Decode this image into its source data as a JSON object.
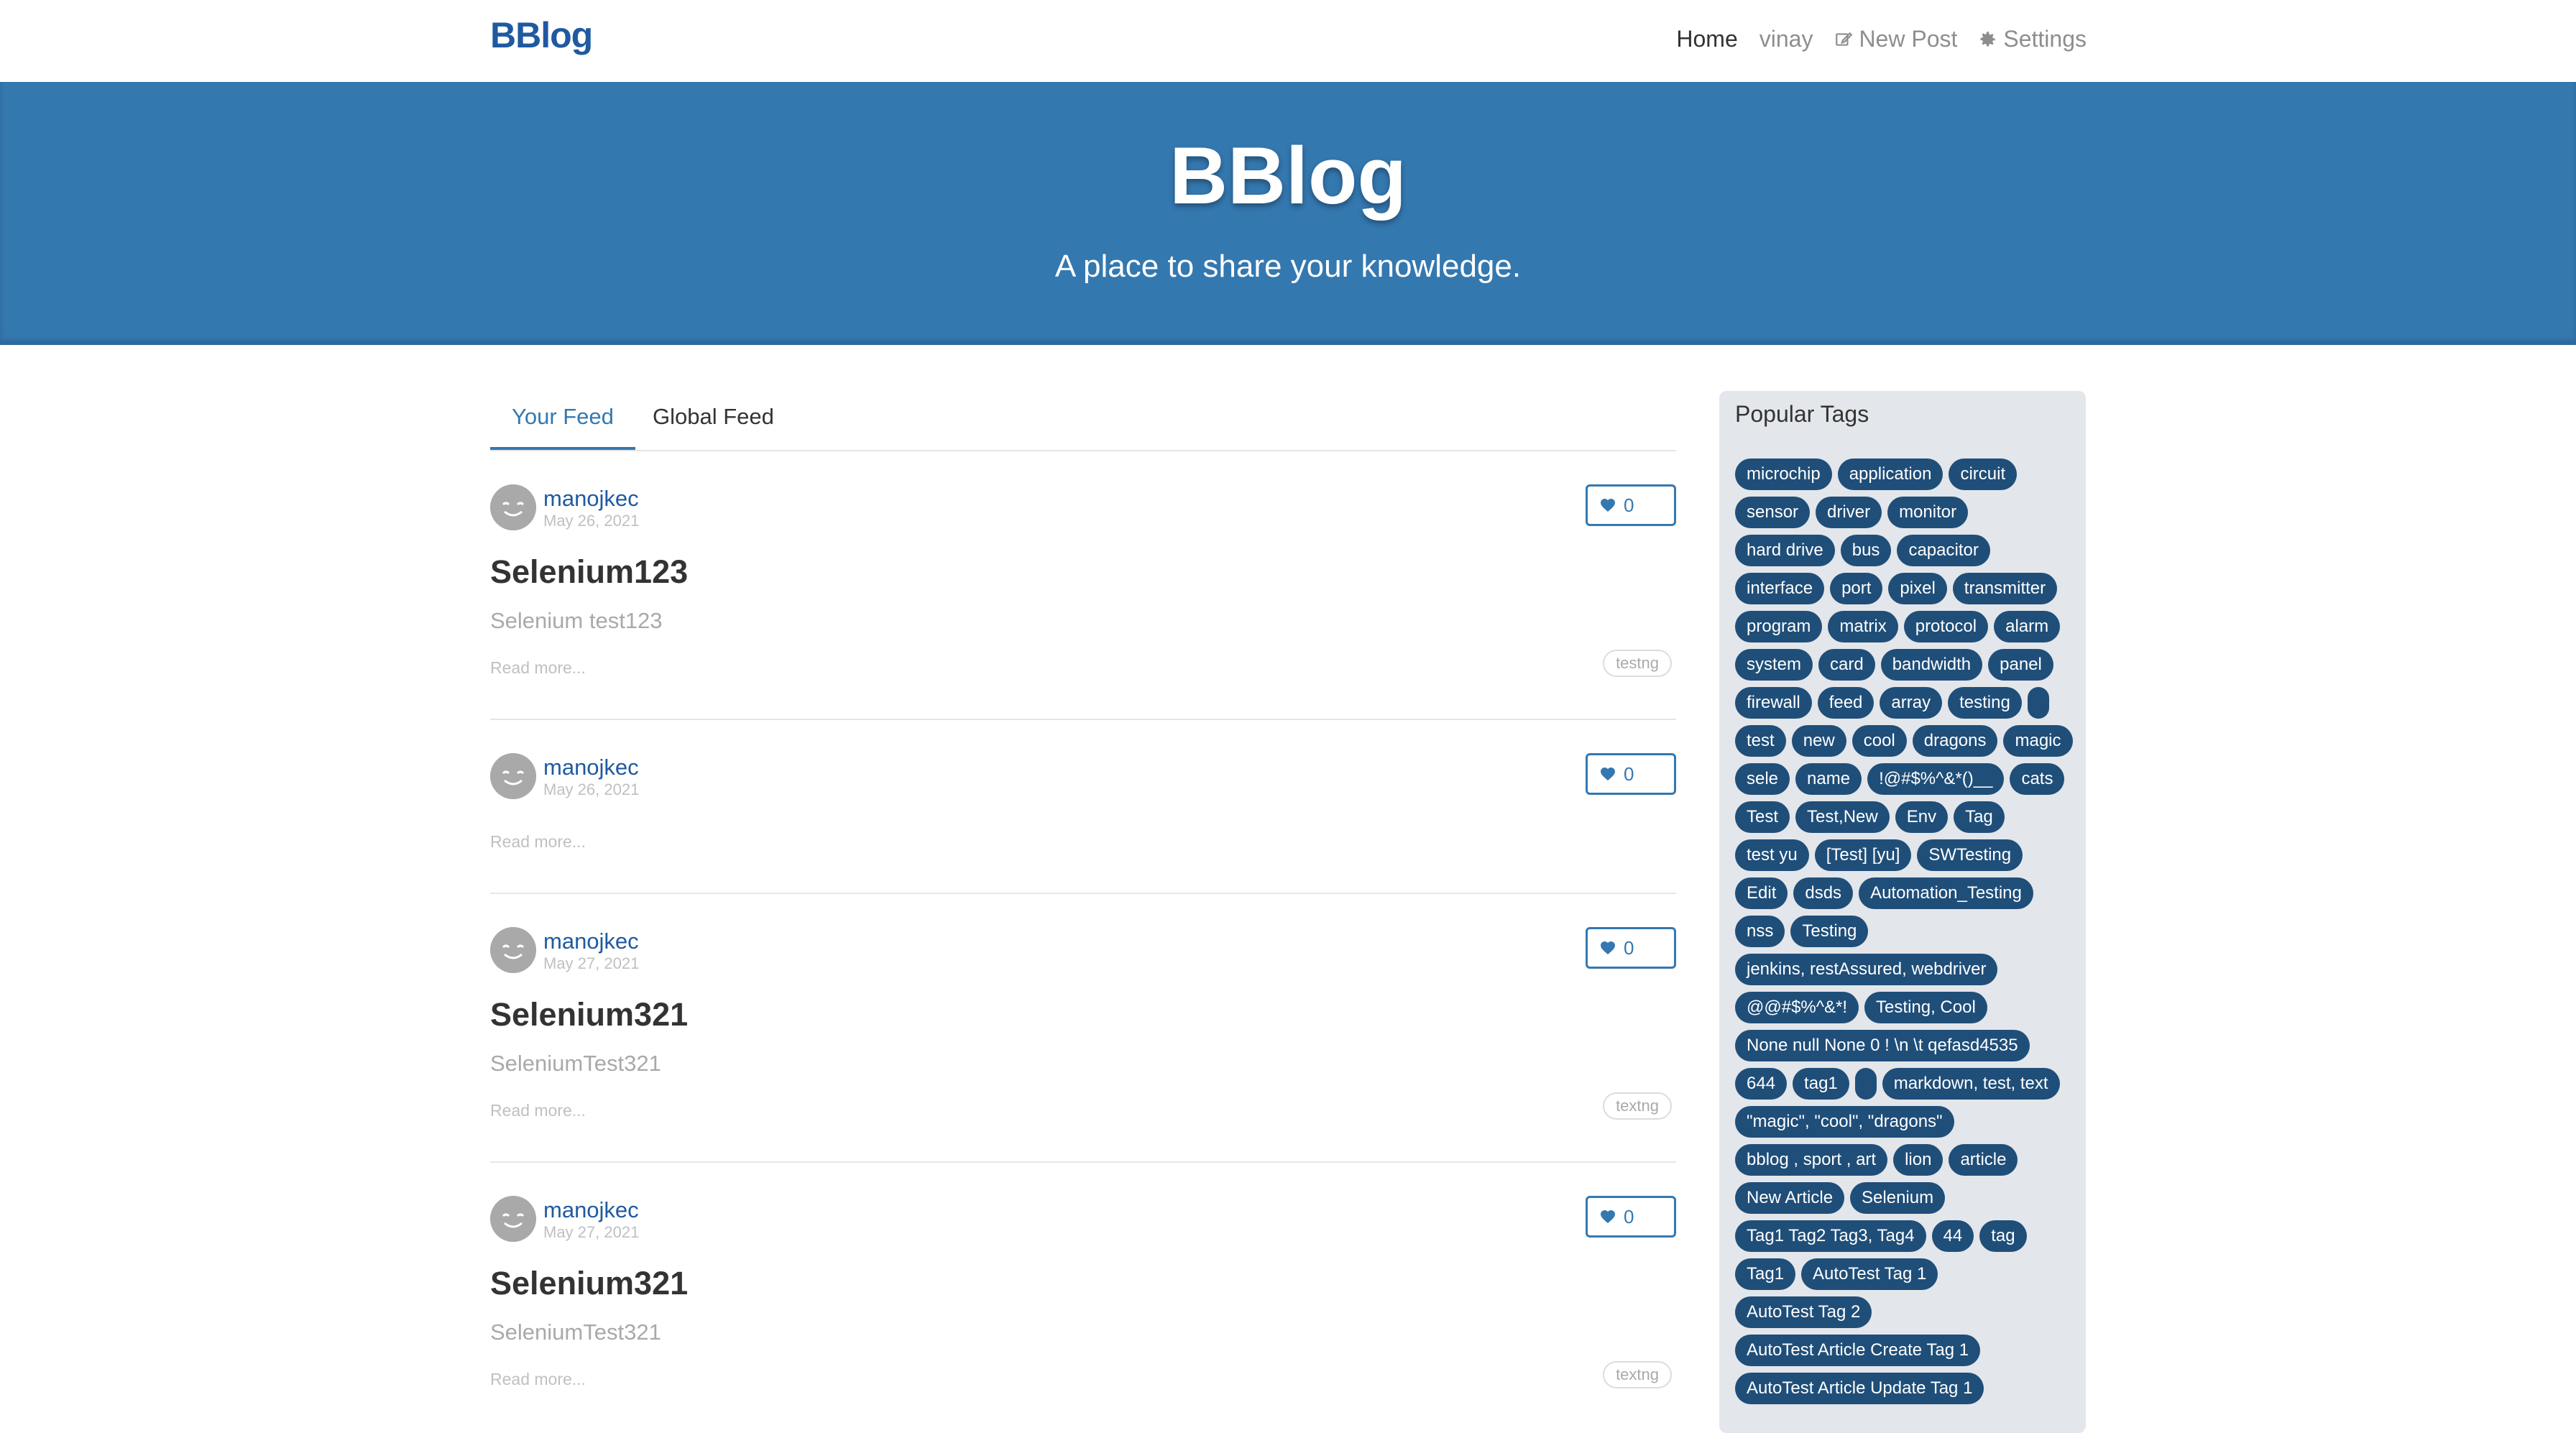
{
  "nav": {
    "brand": "BBlog",
    "links": [
      {
        "label": "Home",
        "icon": ""
      },
      {
        "label": "vinay",
        "icon": ""
      },
      {
        "label": "New Post",
        "icon": "edit-icon"
      },
      {
        "label": "Settings",
        "icon": "gear-icon"
      }
    ]
  },
  "banner": {
    "title": "BBlog",
    "subtitle": "A place to share your knowledge."
  },
  "feed": {
    "tabs": [
      "Your Feed",
      "Global Feed"
    ],
    "articles": [
      {
        "author": "manojkec",
        "date": "May 26, 2021",
        "likes": "0",
        "title": "Selenium123",
        "description": "Selenium test123",
        "read_more": "Read more...",
        "tag": "testng"
      },
      {
        "author": "manojkec",
        "date": "May 26, 2021",
        "likes": "0",
        "title": "",
        "description": "",
        "read_more": "Read more...",
        "tag": ""
      },
      {
        "author": "manojkec",
        "date": "May 27, 2021",
        "likes": "0",
        "title": "Selenium321",
        "description": "SeleniumTest321",
        "read_more": "Read more...",
        "tag": "textng"
      },
      {
        "author": "manojkec",
        "date": "May 27, 2021",
        "likes": "0",
        "title": "Selenium321",
        "description": "SeleniumTest321",
        "read_more": "Read more...",
        "tag": "textng"
      }
    ]
  },
  "sidebar": {
    "title": "Popular Tags",
    "tags": [
      "microchip",
      "application",
      "circuit",
      "sensor",
      "driver",
      "monitor",
      "hard drive",
      "bus",
      "capacitor",
      "interface",
      "port",
      "pixel",
      "transmitter",
      "program",
      "matrix",
      "protocol",
      "alarm",
      "system",
      "card",
      "bandwidth",
      "panel",
      "firewall",
      "feed",
      "array",
      "testing",
      "",
      "test",
      "new",
      "cool",
      "dragons",
      "magic",
      "sele",
      "name",
      "!@#$%^&*()__",
      "cats",
      "Test",
      "Test,New",
      "Env",
      "Tag",
      "test yu",
      "[Test] [yu]",
      "SWTesting",
      "Edit",
      "dsds",
      "Automation_Testing",
      "nss",
      "Testing",
      "jenkins, restAssured, webdriver",
      "@@#$%^&*!",
      "Testing, Cool",
      "None null None 0 ! \\n \\t qefasd4535",
      "644",
      "tag1",
      "",
      "markdown, test, text",
      "\"magic\", \"cool\", \"dragons\"",
      "bblog , sport , art",
      "lion",
      "article",
      "New Article",
      "Selenium",
      "Tag1 Tag2 Tag3, Tag4",
      "44",
      "tag",
      "Tag1",
      "AutoTest Tag 1",
      "AutoTest Tag 2",
      "AutoTest Article Create Tag 1",
      "AutoTest Article Update Tag 1"
    ]
  },
  "colors": {
    "brand": "#1f5aa0",
    "banner": "#3478b0",
    "tag_pill": "#1f4e79",
    "sidebar_bg": "#e3e6ea"
  }
}
